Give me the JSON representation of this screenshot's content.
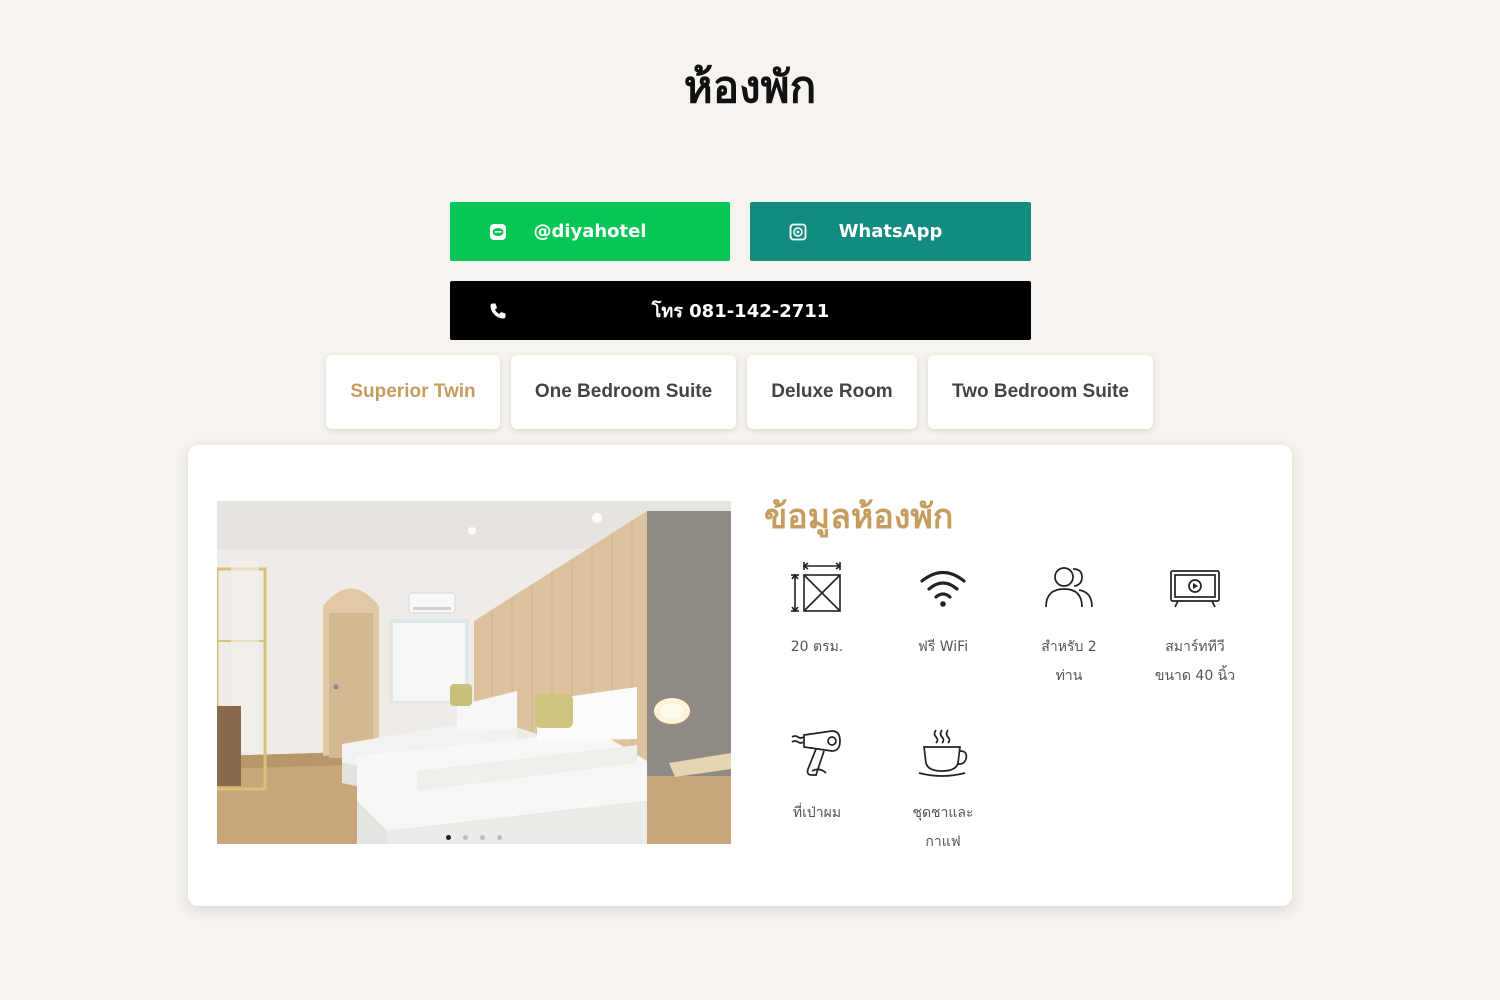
{
  "page_title": "ห้องพัก",
  "contact": {
    "line_label": "@diyahotel",
    "whatsapp_label": "WhatsApp",
    "phone_label": "โทร 081-142-2711"
  },
  "colors": {
    "line": "#06c755",
    "whatsapp": "#128c7e",
    "phone": "#000000",
    "accent": "#c59d5f",
    "background": "#f7f4ef"
  },
  "room_tabs": [
    {
      "label": "Superior Twin",
      "active": true
    },
    {
      "label": "One Bedroom Suite",
      "active": false
    },
    {
      "label": "Deluxe Room",
      "active": false
    },
    {
      "label": "Two Bedroom Suite",
      "active": false
    }
  ],
  "room_info": {
    "title": "ข้อมูลห้องพัก",
    "gallery": {
      "slides": 4,
      "current": 1
    },
    "amenities": [
      {
        "icon": "room-size-icon",
        "line1": "20 ตรม.",
        "line2": ""
      },
      {
        "icon": "wifi-icon",
        "line1": "ฟรี WiFi",
        "line2": ""
      },
      {
        "icon": "guests-icon",
        "line1": "สำหรับ 2",
        "line2": "ท่าน"
      },
      {
        "icon": "smart-tv-icon",
        "line1": "สมาร์ททีวี",
        "line2": "ขนาด 40 นิ้ว"
      },
      {
        "icon": "hair-dryer-icon",
        "line1": "ที่เป่าผม",
        "line2": ""
      },
      {
        "icon": "coffee-cup-icon",
        "line1": "ชุดชาและ",
        "line2": "กาแฟ"
      }
    ]
  }
}
